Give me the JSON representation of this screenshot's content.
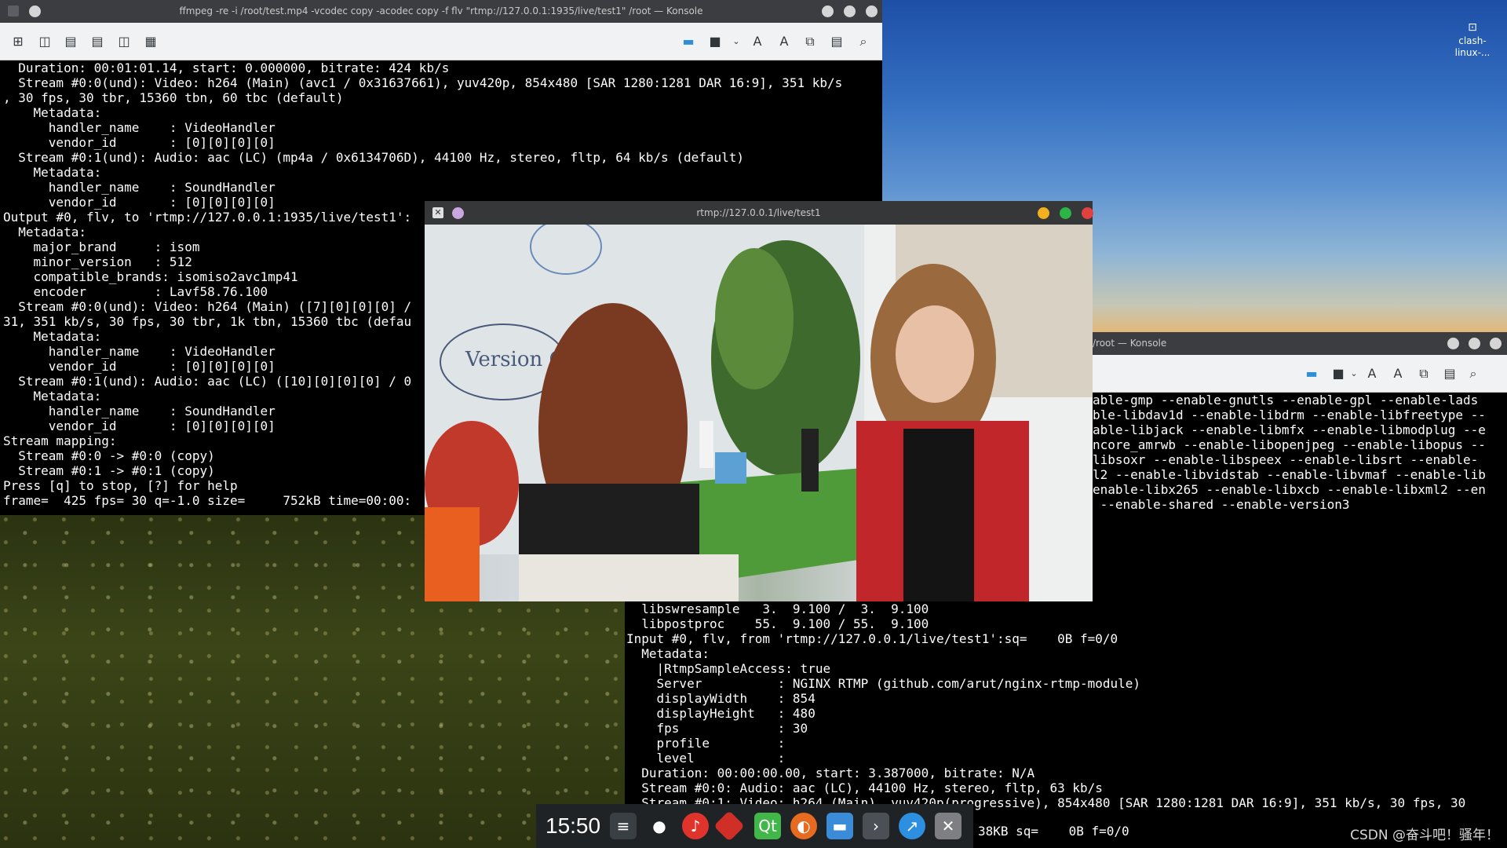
{
  "desktop": {
    "icon_label_line1": "clash-",
    "icon_label_line2": "linux-..."
  },
  "konsole_main": {
    "title": "ffmpeg -re -i /root/test.mp4 -vcodec copy -acodec copy -f flv \"rtmp://127.0.0.1:1935/live/test1\" /root — Konsole",
    "lines": [
      "  Duration: 00:01:01.14, start: 0.000000, bitrate: 424 kb/s",
      "  Stream #0:0(und): Video: h264 (Main) (avc1 / 0x31637661), yuv420p, 854x480 [SAR 1280:1281 DAR 16:9], 351 kb/s",
      ", 30 fps, 30 tbr, 15360 tbn, 60 tbc (default)",
      "    Metadata:",
      "      handler_name    : VideoHandler",
      "      vendor_id       : [0][0][0][0]",
      "  Stream #0:1(und): Audio: aac (LC) (mp4a / 0x6134706D), 44100 Hz, stereo, fltp, 64 kb/s (default)",
      "    Metadata:",
      "      handler_name    : SoundHandler",
      "      vendor_id       : [0][0][0][0]",
      "Output #0, flv, to 'rtmp://127.0.0.1:1935/live/test1':",
      "  Metadata:",
      "    major_brand     : isom",
      "    minor_version   : 512",
      "    compatible_brands: isomiso2avc1mp41",
      "    encoder         : Lavf58.76.100",
      "  Stream #0:0(und): Video: h264 (Main) ([7][0][0][0] /",
      "31, 351 kb/s, 30 fps, 30 tbr, 1k tbn, 15360 tbc (defau",
      "    Metadata:",
      "      handler_name    : VideoHandler",
      "      vendor_id       : [0][0][0][0]",
      "  Stream #0:1(und): Audio: aac (LC) ([10][0][0][0] / 0",
      "    Metadata:",
      "      handler_name    : SoundHandler",
      "      vendor_id       : [0][0][0][0]",
      "Stream mapping:",
      "  Stream #0:0 -> #0:0 (copy)",
      "  Stream #0:1 -> #0:1 (copy)",
      "Press [q] to stop, [?] for help",
      "frame=  425 fps= 30 q=-1.0 size=     752kB time=00:00:"
    ]
  },
  "video_window": {
    "title": "rtmp://127.0.0.1/live/test1",
    "whiteboard_text": "Version Control"
  },
  "konsole_second": {
    "title": "/root — Konsole",
    "top_lines": [
      "able-gmp --enable-gnutls --enable-gpl --enable-lads",
      "ble-libdav1d --enable-libdrm --enable-libfreetype --",
      "able-libjack --enable-libmfx --enable-libmodplug --e",
      "ncore_amrwb --enable-libopenjpeg --enable-libopus --",
      "libsoxr --enable-libspeex --enable-libsrt --enable-",
      "l2 --enable-libvidstab --enable-libvmaf --enable-lib",
      "enable-libx265 --enable-libxcb --enable-libxml2 --en",
      " --enable-shared --enable-version3"
    ],
    "bottom_lines": [
      "  libswresample   3.  9.100 /  3.  9.100",
      "  libpostproc    55.  9.100 / 55.  9.100",
      "Input #0, flv, from 'rtmp://127.0.0.1/live/test1':sq=    0B f=0/0",
      "  Metadata:",
      "    |RtmpSampleAccess: true",
      "    Server          : NGINX RTMP (github.com/arut/nginx-rtmp-module)",
      "    displayWidth    : 854",
      "    displayHeight   : 480",
      "    fps             : 30",
      "    profile         :",
      "    level           :",
      "  Duration: 00:00:00.00, start: 3.387000, bitrate: N/A",
      "  Stream #0:0: Audio: aac (LC), 44100 Hz, stereo, fltp, 63 kb/s",
      "  Stream #0:1: Video: h264 (Main), yuv420p(progressive), 854x480 [SAR 1280:1281 DAR 16:9], 351 kb/s, 30 fps, 30"
    ],
    "status_line": "38KB sq=    0B f=0/0"
  },
  "taskbar": {
    "clock": "15:50",
    "icons": [
      "mixer-icon",
      "qq-penguin-icon",
      "netease-music-icon",
      "git-icon",
      "qt-creator-icon",
      "firefox-icon",
      "files-icon",
      "terminal-icon",
      "browser-icon",
      "tools-icon"
    ]
  },
  "watermark": "CSDN @奋斗吧！骚年！",
  "colors": {
    "terminal_bg": "#000000",
    "terminal_fg": "#fcfcfc",
    "titlebar": "#3b3d40",
    "close_red": "#e0433f",
    "min_yellow": "#f2b01e",
    "max_green": "#2eb346"
  }
}
